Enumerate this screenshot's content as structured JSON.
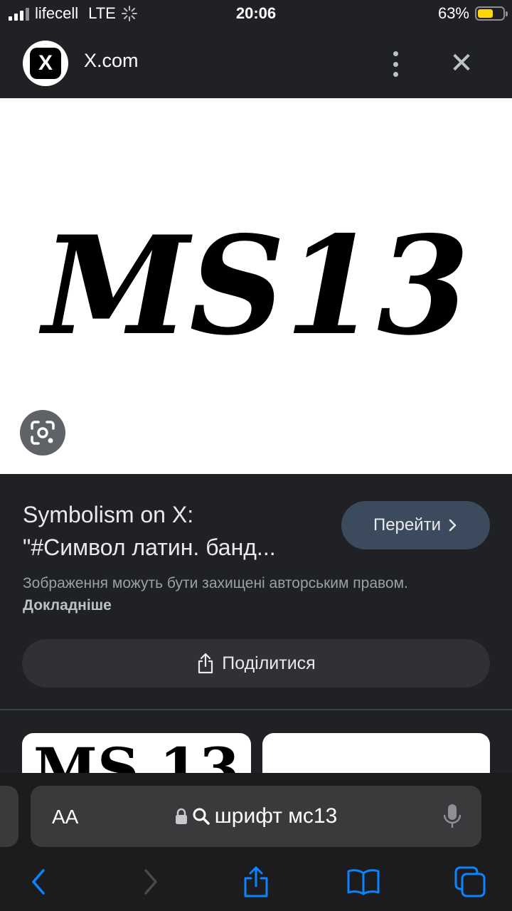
{
  "status": {
    "carrier": "lifecell",
    "network": "LTE",
    "time": "20:06",
    "battery": "63%",
    "battery_level": 0.63,
    "battery_color": "#ffd60a"
  },
  "header": {
    "logo_letter": "X",
    "site": "X.com",
    "more_icon": "more-vert-icon",
    "close_icon": "close-icon"
  },
  "image": {
    "text": "MS13",
    "background": "#ffffff",
    "lens_icon": "lens-icon"
  },
  "result": {
    "title_line1": "Symbolism on X:",
    "title_line2": "\"#Символ латин. банд...",
    "visit_label": "Перейти",
    "copyright_text": "Зображення можуть бути захищені авторським правом.",
    "copyright_link": "Докладніше",
    "share_label": "Поділитися",
    "thumb1_text": "MS 13"
  },
  "browser": {
    "aa_label": "AA",
    "url": "шрифт мс13",
    "lock_icon": "lock-icon",
    "search_icon": "search-icon",
    "mic_icon": "mic-icon",
    "accent": "#0a84ff"
  }
}
